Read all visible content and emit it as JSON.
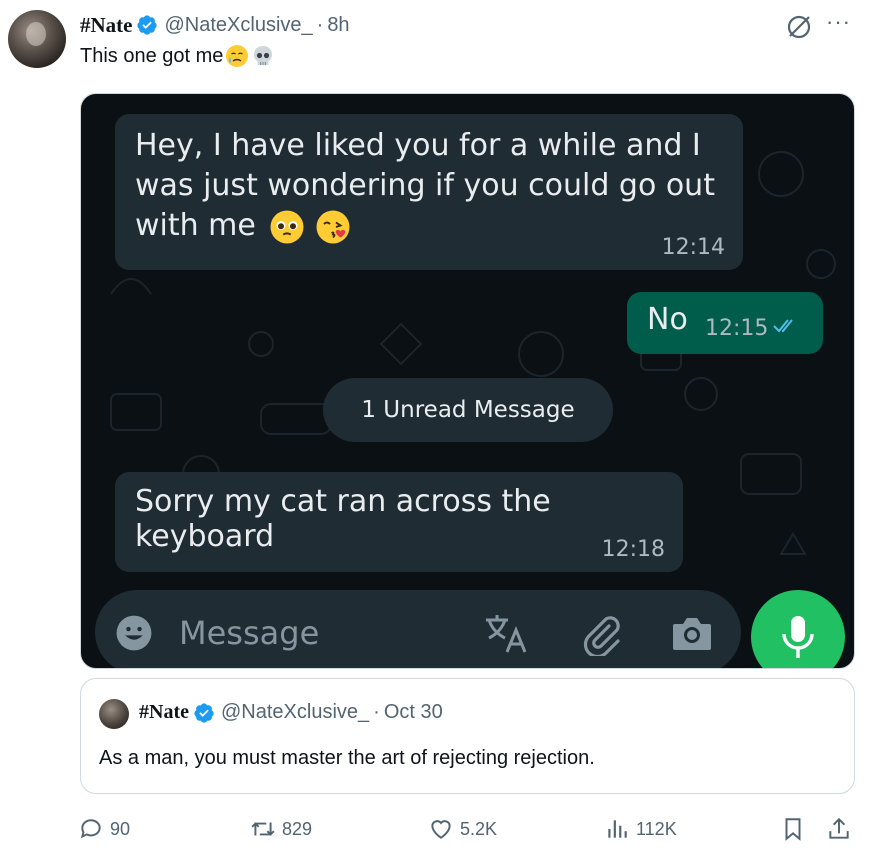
{
  "tweet": {
    "author_name": "#Nate",
    "handle": "@NateXclusive_",
    "separator": "·",
    "time": "8h",
    "text": "This one got me",
    "emojis": [
      "crying-face-emoji",
      "skull-emoji"
    ]
  },
  "chat": {
    "message1": {
      "text": "Hey, I have liked you for a while and I was just wondering if you could go out with me",
      "time": "12:14"
    },
    "message2": {
      "text": "No",
      "time": "12:15"
    },
    "unread_label": "1 Unread Message",
    "message3": {
      "text": "Sorry my cat ran across the keyboard",
      "time": "12:18"
    },
    "input_placeholder": "Message",
    "colors": {
      "background": "#0b1014",
      "incoming": "#1f2c34",
      "outgoing": "#005c4b",
      "mic": "#21c063"
    }
  },
  "quote": {
    "author_name": "#Nate",
    "handle": "@NateXclusive_",
    "separator": "·",
    "date": "Oct 30",
    "text": "As a man, you must master the art of rejecting rejection."
  },
  "actions": {
    "replies": "90",
    "retweets": "829",
    "likes": "5.2K",
    "views": "112K"
  },
  "colors": {
    "verified": "#1d9bf0",
    "secondary_text": "#536471"
  }
}
